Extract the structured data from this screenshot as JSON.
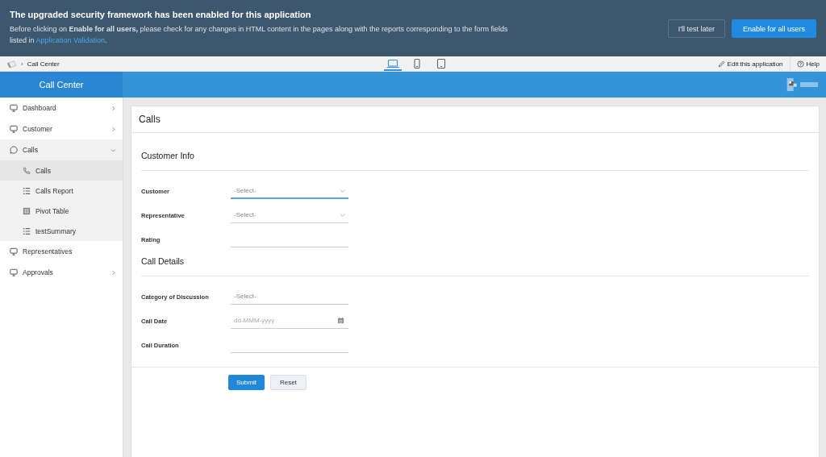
{
  "banner": {
    "title": "The upgraded security framework has been enabled for this application",
    "message": "Before clicking on **Enable for all users,** please check for any changes in HTML content in the pages along with the reports corresponding to the form fields listed in",
    "link": "Application Validation",
    "end": ".",
    "buttons": [
      {
        "label": "I'll test later",
        "kind": "secondary"
      },
      {
        "label": "Enable for all users",
        "kind": "primary"
      }
    ]
  },
  "toolbar": {
    "separator": "›",
    "breadcrumb": "Call Center",
    "devices": [
      {
        "kind": "desktop",
        "selected": true
      },
      {
        "kind": "phone",
        "selected": false
      },
      {
        "kind": "tablet",
        "selected": false
      }
    ],
    "edit": "Edit this application",
    "help": "Help"
  },
  "app": {
    "title": "Call Center"
  },
  "sidebar": {
    "items": [
      {
        "label": "Dashboard",
        "kind": "monitor",
        "expandable": true,
        "expanded": false,
        "selected": false
      },
      {
        "label": "Customer",
        "kind": "monitor",
        "expandable": true,
        "expanded": false,
        "selected": false
      },
      {
        "label": "Calls",
        "kind": "chat",
        "expandable": true,
        "expanded": true,
        "selected": false,
        "children": [
          {
            "label": "Calls",
            "kind": "phone",
            "selected": true
          },
          {
            "label": "Calls Report",
            "kind": "list",
            "selected": false
          },
          {
            "label": "Pivot Table",
            "kind": "grid",
            "selected": false
          },
          {
            "label": "testSummary",
            "kind": "list",
            "selected": false
          }
        ]
      },
      {
        "label": "Representatives",
        "kind": "monitor",
        "expandable": false,
        "expanded": false,
        "selected": false
      },
      {
        "label": "Approvals",
        "kind": "monitor",
        "expandable": true,
        "expanded": false,
        "selected": false
      }
    ]
  },
  "form": {
    "title": "Calls",
    "sections": [
      {
        "title": "Customer Info",
        "fields": [
          {
            "label": "Customer",
            "kind": "select",
            "placeholder": "-Select-",
            "focused": true
          },
          {
            "label": "Representative",
            "kind": "select",
            "placeholder": "-Select-",
            "focused": false
          },
          {
            "label": "Rating",
            "kind": "text",
            "focused": false
          }
        ]
      },
      {
        "title": "Call Details",
        "fields": [
          {
            "label": "Category of Discussion",
            "kind": "text",
            "placeholder": "-Select-",
            "focused": false
          },
          {
            "label": "Call Date",
            "kind": "date",
            "placeholder": "dd-MMM-yyyy",
            "focused": false
          },
          {
            "label": "Call Duration",
            "kind": "text",
            "focused": false
          }
        ]
      }
    ],
    "buttons": [
      {
        "label": "Submit",
        "kind": "primary"
      },
      {
        "label": "Reset",
        "kind": "secondary"
      }
    ]
  }
}
